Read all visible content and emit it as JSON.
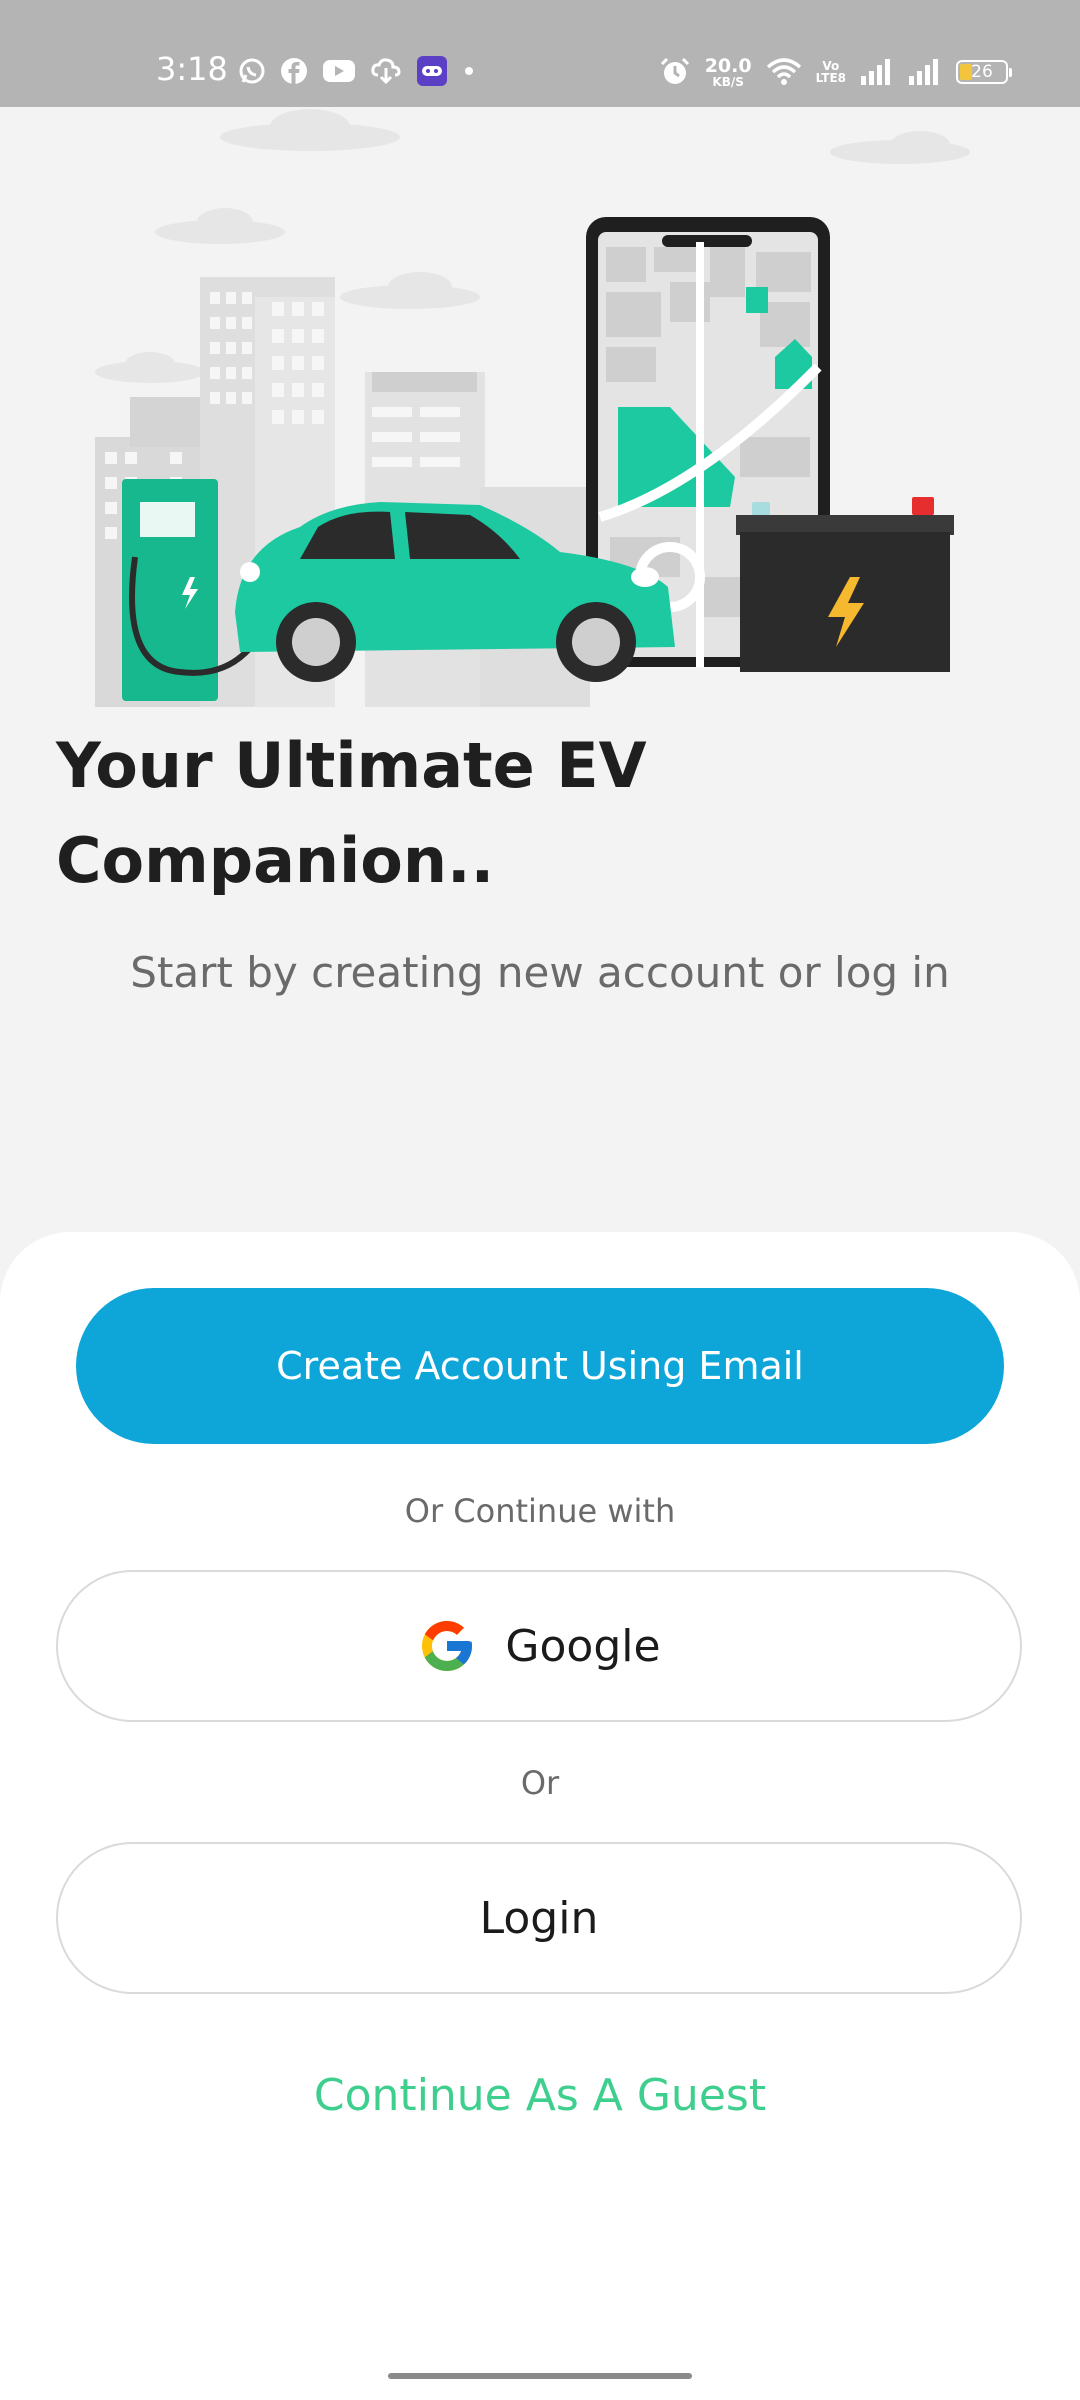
{
  "status_bar": {
    "time": "3:18",
    "net_speed_value": "20.0",
    "net_speed_unit": "KB/S",
    "volte_top": "Vo",
    "volte_bottom": "LTE8",
    "battery_level": "26",
    "left_icons": [
      "whatsapp-icon",
      "facebook-icon",
      "youtube-icon",
      "cloud-download-icon",
      "game-controller-icon",
      "dot-icon"
    ],
    "right_icons": [
      "alarm-icon",
      "wifi-icon",
      "signal-icon",
      "signal-icon",
      "battery-icon"
    ]
  },
  "hero": {
    "illustration": "ev-charging-city-illustration",
    "colors": {
      "teal": "#1dc9a0",
      "dark": "#2b2b2b",
      "bolt": "#f5b82e",
      "building": "#dcdcdc"
    }
  },
  "headline": {
    "line1": "Your Ultimate EV",
    "line2": "Companion.."
  },
  "subtitle": "Start by creating new account or log in",
  "actions": {
    "create_account_label": "Create Account Using Email",
    "or_continue_with": "Or Continue with",
    "google_label": "Google",
    "or_label": "Or",
    "login_label": "Login",
    "guest_label": "Continue As A Guest"
  },
  "colors": {
    "primary": "#0ea5d9",
    "accent_green": "#3ecf8e",
    "status_bar": "#b4b4b4"
  }
}
